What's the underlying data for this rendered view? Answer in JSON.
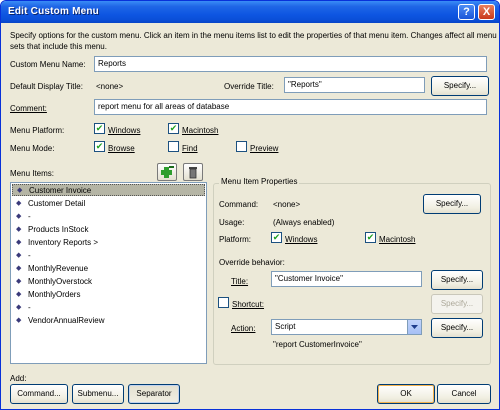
{
  "window": {
    "title": "Edit Custom Menu",
    "help": "?",
    "close": "X"
  },
  "intro": "Specify options for the custom menu. Click an item in the menu items list to edit the properties of that menu item. Changes affect all menu sets that include this menu.",
  "intro_line1": "Specify options for the custom menu. Click an item in the menu items list to edit the properties of that menu item. Changes affect all menu",
  "intro_line2": "sets that include this menu.",
  "custom_menu_name": {
    "label": "Custom Menu Name:",
    "value": "Reports"
  },
  "default_display_title": {
    "label": "Default Display Title:",
    "value": "<none>"
  },
  "override_title": {
    "label": "Override Title:",
    "value": "\"Reports\"",
    "button": "Specify..."
  },
  "comment": {
    "label": "Comment:",
    "value": "report menu for all areas of database"
  },
  "menu_platform": {
    "label": "Menu Platform:",
    "windows": "Windows",
    "macintosh": "Macintosh",
    "windows_checked": true,
    "macintosh_checked": true
  },
  "menu_mode": {
    "label": "Menu Mode:",
    "browse": "Browse",
    "find": "Find",
    "preview": "Preview",
    "browse_checked": true,
    "find_checked": false,
    "preview_checked": false
  },
  "menu_items": {
    "label": "Menu Items:",
    "items": [
      "Customer Invoice",
      "Customer Detail",
      "-",
      "Products InStock",
      "Inventory Reports >",
      "-",
      "MonthlyRevenue",
      "MonthlyOverstock",
      "MonthlyOrders",
      "-",
      "VendorAnnualReview"
    ],
    "selected_index": 0
  },
  "props": {
    "title": "Menu Item Properties",
    "command_label": "Command:",
    "command_value": "<none>",
    "command_button": "Specify...",
    "usage_label": "Usage:",
    "usage_value": "(Always enabled)",
    "platform_label": "Platform:",
    "platform_windows": "Windows",
    "platform_macintosh": "Macintosh",
    "override_behavior": "Override behavior:",
    "title_label": "Title:",
    "title_value": "\"Customer Invoice\"",
    "title_button": "Specify...",
    "shortcut_label": "Shortcut:",
    "shortcut_button": "Specify...",
    "action_label": "Action:",
    "action_value": "Script",
    "action_button": "Specify...",
    "action_detail": "\"report CustomerInvoice\""
  },
  "add": {
    "label": "Add:",
    "command": "Command...",
    "submenu": "Submenu...",
    "separator": "Separator"
  },
  "ok": "OK",
  "cancel": "Cancel",
  "colors": {
    "titlebar": "#0A4FD8",
    "dialog_bg": "#ECE9D8",
    "selection": "#B5B5A5",
    "check": "#21A121"
  }
}
